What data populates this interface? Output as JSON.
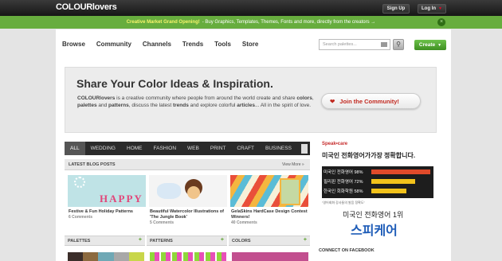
{
  "header": {
    "logo": "COLOURlovers",
    "signup": "Sign Up",
    "login": "Log In"
  },
  "promo": {
    "bold": "Creative Market Grand Opening!",
    "text": "- Buy Graphics, Templates, Themes, Fonts and more, directly from the creators →"
  },
  "nav": {
    "items": [
      "Browse",
      "Community",
      "Channels",
      "Trends",
      "Tools",
      "Store"
    ],
    "search_placeholder": "Search palettes...",
    "create": "Create"
  },
  "hero": {
    "title": "Share Your Color Ideas & Inspiration.",
    "join": "Join the Community!"
  },
  "tabs": [
    "ALL",
    "WEDDING",
    "HOME",
    "FASHION",
    "WEB",
    "PRINT",
    "CRAFT",
    "BUSINESS"
  ],
  "blog": {
    "header": "LATEST BLOG POSTS",
    "view_more": "View More »",
    "posts": [
      {
        "title": "Festive & Fun Holiday Patterns",
        "comments": "6 Comments",
        "img_text": "HAPPY HO"
      },
      {
        "title": "Beautiful Watercolor Illustrations of 'The Jungle Book'",
        "comments": "5 Comments"
      },
      {
        "title": "GelaSkins HardCase Design Contest Winners!",
        "comments": "40 Comments"
      }
    ]
  },
  "sections": {
    "palettes": "PALETTES",
    "patterns": "PATTERNS",
    "colors": "COLORS"
  },
  "ad": {
    "brand": "Speak•care",
    "headline": "미국인 전화영어가가장 정확합니다.",
    "bars": [
      {
        "label": "미국인 전화영어 98%",
        "level": 0.98
      },
      {
        "label": "필리핀 전화영어 72%",
        "level": 0.72
      },
      {
        "label": "한국인 회화학원 58%",
        "level": 0.58
      }
    ],
    "small": "“영어회화 강사들의 발음 정확도”",
    "line1": "미국인 전화영어 1위",
    "line2": "스피케어"
  },
  "facebook": "CONNECT ON FACEBOOK",
  "colors": {
    "accent": "#67ad3e",
    "join_red": "#c0271e",
    "topbar": "#222222"
  }
}
